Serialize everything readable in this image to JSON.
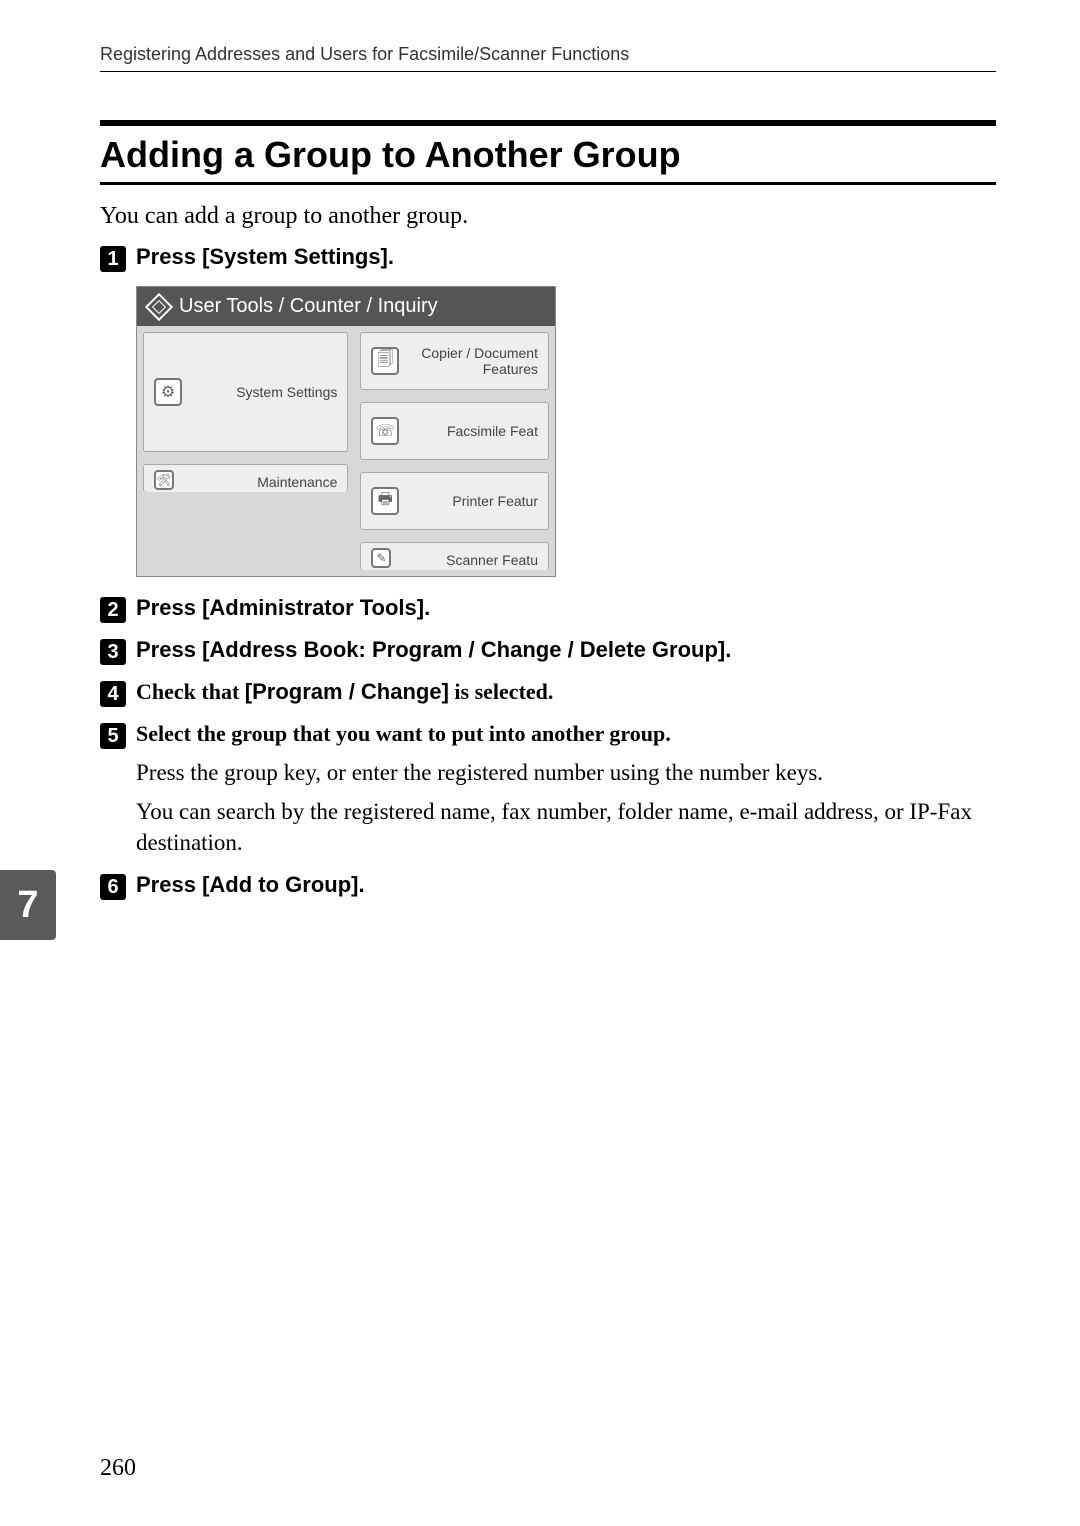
{
  "header": "Registering Addresses and Users for Facsimile/Scanner Functions",
  "section_title": "Adding a Group to Another Group",
  "intro": "You can add a group to another group.",
  "steps": [
    {
      "num": "1",
      "prefix": "Press ",
      "bold": "[System Settings]",
      "suffix": "."
    },
    {
      "num": "2",
      "prefix": "Press ",
      "bold": "[Administrator Tools]",
      "suffix": "."
    },
    {
      "num": "3",
      "prefix": "Press ",
      "bold": "[Address Book: Program / Change / Delete Group]",
      "suffix": "."
    },
    {
      "num": "4",
      "prefix_serif": "Check that ",
      "bold": "[Program / Change]",
      "suffix_serif": " is selected."
    },
    {
      "num": "5",
      "full_serif": "Select the group that you want to put into another group.",
      "body1": "Press the group key, or enter the registered number using the number keys.",
      "body2": "You can search by the registered name, fax number, folder name, e-mail address, or IP-Fax destination."
    },
    {
      "num": "6",
      "prefix": "Press ",
      "bold": "[Add to Group]",
      "suffix": "."
    }
  ],
  "screenshot": {
    "title": "User Tools / Counter / Inquiry",
    "left": [
      {
        "label": "System Settings",
        "icon": "settings-icon"
      },
      {
        "label": "Maintenance",
        "icon": "wrench-icon"
      }
    ],
    "right": [
      {
        "label": "Copier / Document Features",
        "icon": "copier-icon"
      },
      {
        "label": "Facsimile Feat",
        "icon": "fax-icon"
      },
      {
        "label": "Printer Featur",
        "icon": "printer-icon"
      },
      {
        "label": "Scanner Featu",
        "icon": "scanner-icon"
      }
    ]
  },
  "chapter": "7",
  "page_number": "260"
}
